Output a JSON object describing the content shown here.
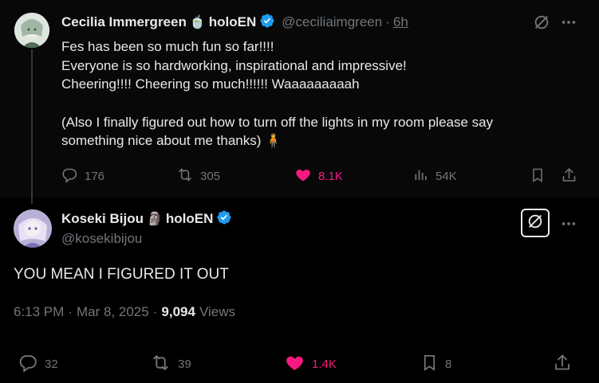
{
  "post1": {
    "author_name": "Cecilia Immergreen",
    "author_badge_emoji": "🍵",
    "author_suffix": "holoEN",
    "handle": "@ceciliaimgreen",
    "separator": "·",
    "time": "6h",
    "lines": [
      "Fes has been so much fun so far!!!!",
      "Everyone is so hardworking, inspirational and impressive!",
      "Cheering!!!! Cheering so much!!!!!! Waaaaaaaaah",
      "",
      "(Also I finally figured out how to turn off the lights in my room please say",
      "something nice about me thanks) 🧍"
    ],
    "replies": "176",
    "reposts": "305",
    "likes": "8.1K",
    "views": "54K"
  },
  "post2": {
    "author_name": "Koseki Bijou",
    "author_badge_emoji": "🗿",
    "author_suffix": "holoEN",
    "handle": "@kosekibijou",
    "text": "YOU MEAN I FIGURED IT OUT",
    "time": "6:13 PM",
    "date": "Mar 8, 2025",
    "views_count": "9,094",
    "views_label": "Views",
    "replies": "32",
    "reposts": "39",
    "likes": "1.4K",
    "bookmarks": "8"
  },
  "colors": {
    "background": "#000000",
    "text": "#e7e9ea",
    "muted": "#71767b",
    "like": "#f91880",
    "verified": "#1d9bf0"
  },
  "icons": [
    "grok-icon",
    "more-icon",
    "reply-icon",
    "repost-icon",
    "heart-icon",
    "analytics-icon",
    "bookmark-icon",
    "share-icon",
    "verified-icon"
  ]
}
